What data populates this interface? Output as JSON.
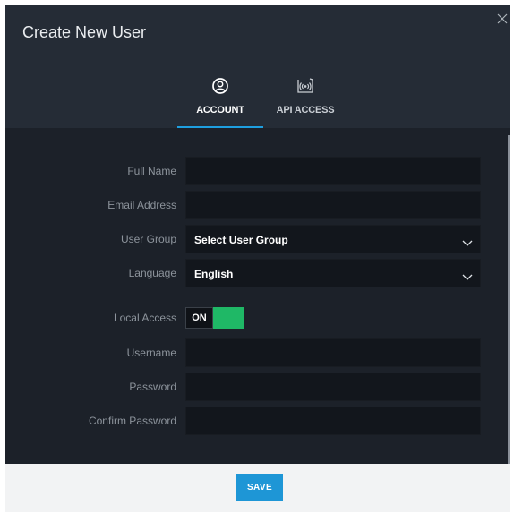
{
  "dialog": {
    "title": "Create New User"
  },
  "tabs": [
    {
      "label": "ACCOUNT",
      "icon": "user-circle-icon",
      "active": true
    },
    {
      "label": "API ACCESS",
      "icon": "broadcast-icon",
      "active": false
    }
  ],
  "form": {
    "full_name": {
      "label": "Full Name",
      "value": ""
    },
    "email": {
      "label": "Email Address",
      "value": ""
    },
    "user_group": {
      "label": "User Group",
      "value": "Select User Group"
    },
    "language": {
      "label": "Language",
      "value": "English"
    },
    "local_access": {
      "label": "Local Access",
      "state": "ON"
    },
    "username": {
      "label": "Username",
      "value": ""
    },
    "password": {
      "label": "Password",
      "value": ""
    },
    "confirm_password": {
      "label": "Confirm Password",
      "value": ""
    }
  },
  "footer": {
    "save_label": "SAVE"
  },
  "colors": {
    "accent": "#1e96d6",
    "toggle_on": "#1fb866",
    "header_bg": "#252c36",
    "body_bg": "#1c2129"
  }
}
